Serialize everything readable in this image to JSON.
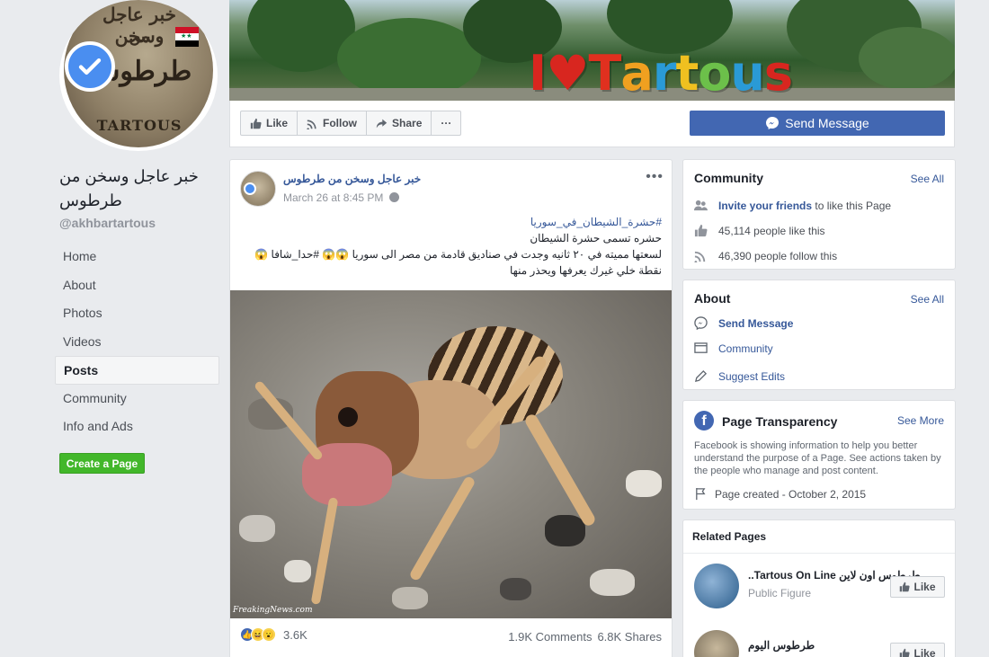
{
  "page": {
    "name": "خبر عاجل وسخن من طرطوس",
    "handle": "@akhbartartous",
    "profile_text": {
      "line1": "خبر عاجل وسخن",
      "line2": "من",
      "line3": "طرطوس",
      "line4": "TARTOUS"
    }
  },
  "nav": {
    "items": [
      {
        "label": "Home"
      },
      {
        "label": "About"
      },
      {
        "label": "Photos"
      },
      {
        "label": "Videos"
      },
      {
        "label": "Posts",
        "active": true
      },
      {
        "label": "Community"
      },
      {
        "label": "Info and Ads"
      }
    ],
    "create_page_label": "Create a Page"
  },
  "cover": {
    "letters": [
      "I",
      "♥",
      "T",
      "a",
      "r",
      "t",
      "o",
      "u",
      "s"
    ],
    "letter_colors": [
      "#d8261f",
      "#d8261f",
      "#e0301f",
      "#f0a020",
      "#2a9ad6",
      "#f0c020",
      "#6cc04a",
      "#2a9ad6",
      "#d8261f"
    ]
  },
  "actions": {
    "like": "Like",
    "follow": "Follow",
    "share": "Share",
    "more": "···",
    "send_message": "Send Message"
  },
  "post": {
    "author": "خبر عاجل وسخن من طرطوس",
    "time": "March 26 at 8:45 PM",
    "more": "•••",
    "hashtag": "#حشرة_الشيطان_في_سوريا",
    "line2": "حشره تسمى حشرة الشيطان",
    "line3": "لسعتها مميته في ٢٠ ثانيه وجدت في صناديق قادمة من مصر الى سوريا 😱😱 #حدا_شافا 😱",
    "line4": "نقطة خلي غيرك يعرفها ويحذر منها",
    "watermark": "FreakingNews.com",
    "reaction_count": "3.6K",
    "comments": "1.9K Comments",
    "shares": "6.8K Shares"
  },
  "community": {
    "title": "Community",
    "see_all": "See All",
    "invite_bold": "Invite your friends",
    "invite_rest": " to like this Page",
    "likes": "45,114 people like this",
    "follows": "46,390 people follow this"
  },
  "about": {
    "title": "About",
    "see_all": "See All",
    "send_message": "Send Message",
    "community": "Community",
    "suggest_edits": "Suggest Edits"
  },
  "transparency": {
    "title": "Page Transparency",
    "see_more": "See More",
    "description": "Facebook is showing information to help you better understand the purpose of a Page. See actions taken by the people who manage and post content.",
    "created": "Page created - October 2, 2015"
  },
  "related": {
    "title": "Related Pages",
    "items": [
      {
        "name": "طرطوس اون لاين Tartous On Line..",
        "category": "Public Figure",
        "like": "Like"
      },
      {
        "name": "طرطوس اليوم",
        "like": "Like"
      }
    ]
  },
  "colors": {
    "brand": "#4267b2",
    "link": "#365899",
    "create_green": "#42b72a"
  }
}
